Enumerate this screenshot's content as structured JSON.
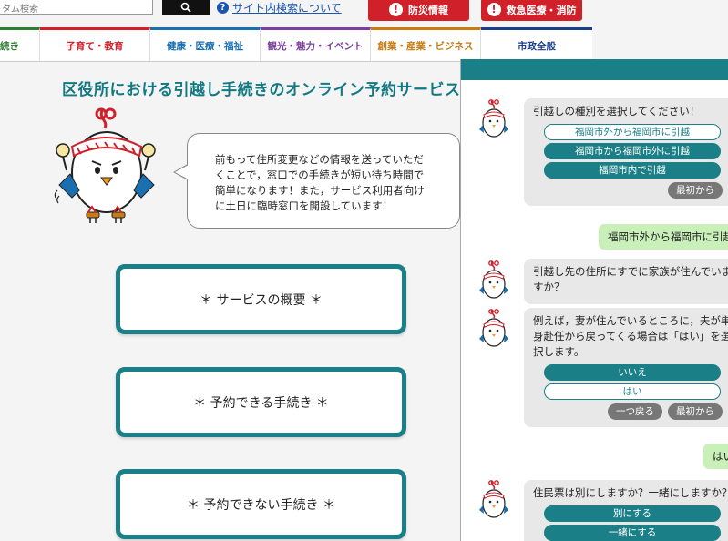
{
  "header": {
    "search_placeholder": "タム検索",
    "search_help": "サイト内検索について",
    "help_icon_char": "?",
    "emergency_buttons": [
      "防災情報",
      "救急医療・消防"
    ]
  },
  "nav": {
    "items": [
      {
        "label": "続き",
        "color": "#2e7d32"
      },
      {
        "label": "子育て・教育",
        "color": "#d0212a"
      },
      {
        "label": "健康・医療・福祉",
        "color": "#1a6fb0"
      },
      {
        "label": "観光・魅力・イベント",
        "color": "#7b3f9e"
      },
      {
        "label": "創業・産業・ビジネス",
        "color": "#c77b12"
      },
      {
        "label": "市政全般",
        "color": "#1a3e8a"
      }
    ]
  },
  "main": {
    "title": "区役所における引越し手続きのオンライン予約サービス",
    "speech": "前もって住所変更などの情報を送っていただくことで，窓口での手続きが短い待ち時間で簡単になります！また，サービス利用者向けに土日に臨時窓口を開設しています！",
    "buttons": [
      "＊ サービスの概要 ＊",
      "＊ 予約できる手続き ＊",
      "＊ 予約できない手続き ＊"
    ]
  },
  "chat": {
    "msg1": {
      "text": "引越しの種別を選択してください！",
      "options": [
        "福岡市外から福岡市に引越",
        "福岡市から福岡市外に引越",
        "福岡市内で引越"
      ],
      "restart": "最初から"
    },
    "user1": "福岡市外から福岡市に引越",
    "msg2": {
      "text": "引越し先の住所にすでに家族が住んでいますか？"
    },
    "msg3": {
      "text": "例えば，妻が住んでいるところに，夫が単身赴任から戻ってくる場合は「はい」を選択します。",
      "options": [
        "いいえ",
        "はい"
      ],
      "back": "一つ戻る",
      "restart": "最初から"
    },
    "user2": "はい",
    "msg4": {
      "text": "住民票は別にしますか？一緒にしますか？",
      "options": [
        "別にする",
        "一緒にする"
      ]
    }
  },
  "colors": {
    "teal": "#1a7f86",
    "red": "#d0212a",
    "user_bubble": "#c8f0b8"
  }
}
